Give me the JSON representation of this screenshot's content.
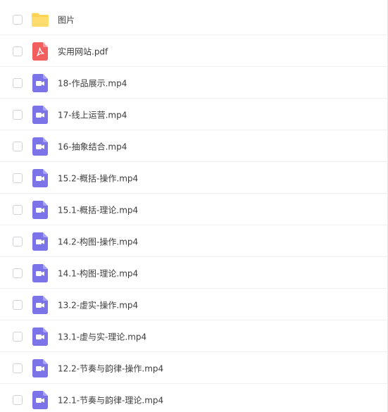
{
  "files": [
    {
      "name": "图片",
      "icon": "folder-icon"
    },
    {
      "name": "实用网站.pdf",
      "icon": "pdf-icon"
    },
    {
      "name": "18-作品展示.mp4",
      "icon": "video-icon"
    },
    {
      "name": "17-线上运营.mp4",
      "icon": "video-icon"
    },
    {
      "name": "16-抽象结合.mp4",
      "icon": "video-icon"
    },
    {
      "name": "15.2-概括-操作.mp4",
      "icon": "video-icon"
    },
    {
      "name": "15.1-概括-理论.mp4",
      "icon": "video-icon"
    },
    {
      "name": "14.2-构图-操作.mp4",
      "icon": "video-icon"
    },
    {
      "name": "14.1-构图-理论.mp4",
      "icon": "video-icon"
    },
    {
      "name": "13.2-虚实-操作.mp4",
      "icon": "video-icon"
    },
    {
      "name": "13.1-虚与实-理论.mp4",
      "icon": "video-icon"
    },
    {
      "name": "12.2-节奏与韵律-操作.mp4",
      "icon": "video-icon"
    },
    {
      "name": "12.1-节奏与韵律-理论.mp4",
      "icon": "video-icon"
    }
  ],
  "colors": {
    "folder": "#ffd452",
    "pdf": "#f25d5d",
    "video": "#7a74e8",
    "text": "#3c3c3c"
  }
}
